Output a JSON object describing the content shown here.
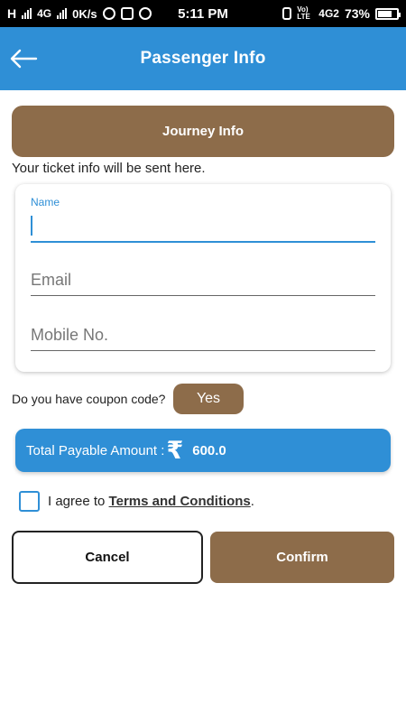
{
  "status_bar": {
    "network_left": "H",
    "network_small": "R",
    "network_4g": "4G",
    "speed": "0K/s",
    "time": "5:11 PM",
    "volte": "Vo) LTE",
    "network_right": "4G2",
    "battery": "73%"
  },
  "app_bar": {
    "title": "Passenger Info",
    "back_icon": "arrow-left-icon"
  },
  "journey": {
    "button_label": "Journey Info"
  },
  "ticket_info_text": "Your ticket info will be sent here.",
  "form": {
    "name_label": "Name",
    "name_value": "",
    "email_placeholder": "Email",
    "mobile_placeholder": "Mobile No."
  },
  "coupon": {
    "question": "Do you have coupon code?",
    "button_label": "Yes"
  },
  "total": {
    "label": "Total Payable Amount :",
    "currency_symbol": "₹",
    "amount": "600.0"
  },
  "terms": {
    "prefix": "I agree to ",
    "link_text": "Terms and Conditions",
    "suffix": ".",
    "checked": false
  },
  "actions": {
    "cancel_label": "Cancel",
    "confirm_label": "Confirm"
  },
  "colors": {
    "primary_blue": "#2f8fd6",
    "brown": "#8d6c4a",
    "status_bar": "#000000"
  }
}
